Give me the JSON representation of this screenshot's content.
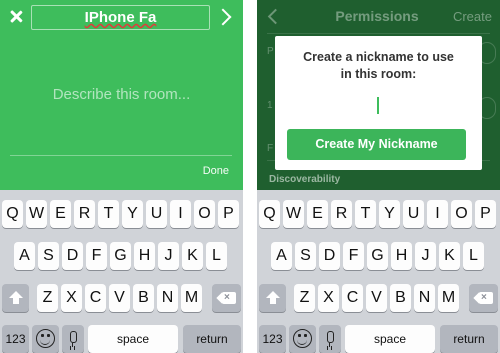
{
  "left": {
    "header": {
      "title_value": "IPhone Fa"
    },
    "description": {
      "placeholder": "Describe this room..."
    },
    "done_label": "Done"
  },
  "right": {
    "nav": {
      "title": "Permissions",
      "create_label": "Create"
    },
    "background_section": {
      "discoverability_label": "Discoverability",
      "partial_chars": [
        "P",
        "1",
        "F"
      ]
    },
    "modal": {
      "title_line1": "Create a nickname to use",
      "title_line2": "in this room:",
      "input_value": "",
      "button_label": "Create My Nickname"
    }
  },
  "keyboard": {
    "row1": [
      "Q",
      "W",
      "E",
      "R",
      "T",
      "Y",
      "U",
      "I",
      "O",
      "P"
    ],
    "row2": [
      "A",
      "S",
      "D",
      "F",
      "G",
      "H",
      "J",
      "K",
      "L"
    ],
    "row3": [
      "Z",
      "X",
      "C",
      "V",
      "B",
      "N",
      "M"
    ],
    "numbers_label": "123",
    "space_label": "space",
    "return_label": "return"
  },
  "icons": {
    "close": "close-icon",
    "next": "chevron-right-icon",
    "back": "chevron-left-icon",
    "shift": "shift-icon",
    "delete": "backspace-icon",
    "emoji": "emoji-icon",
    "microphone": "microphone-icon"
  },
  "colors": {
    "accent_green": "#3ebd5c",
    "dimmed_green": "#1f5f2f",
    "button_green": "#3cb55a",
    "keyboard_bg": "#d0d3d8",
    "key_gray": "#b2b6be"
  }
}
